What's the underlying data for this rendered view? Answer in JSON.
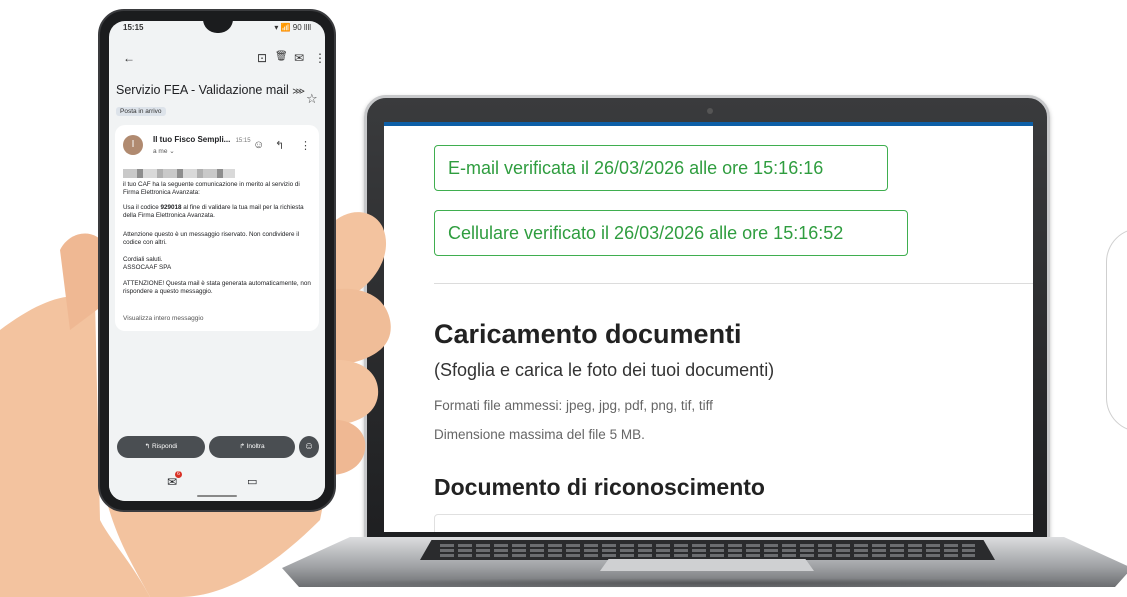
{
  "phone": {
    "status_time": "15:15",
    "status_icons": "▾ 📶 90 llll",
    "toolbar": {
      "back": "←",
      "archive": "⊡",
      "delete": "🗑",
      "mark": "✉",
      "more": "⋮"
    },
    "subject": "Servizio FEA - Validazione mail",
    "subject_arrow": "⋙",
    "label_chip": "Posta in arrivo",
    "message": {
      "avatar_letter": "I",
      "sender": "Il tuo Fisco Sempli...",
      "time": "15:15",
      "to": "a me ⌄",
      "intro": "il tuo CAF ha la seguente comunicazione in merito al servizio di Firma Elettronica Avanzata:",
      "code_prefix": "Usa il codice ",
      "code": "929018",
      "code_suffix": " al fine di validare la tua mail per la richiesta della Firma Elettronica Avanzata.",
      "attention": "Attenzione questo è un messaggio riservato. Non condividere il codice con altri.",
      "greeting": "Cordiali saluti.",
      "company": "ASSOCAAF SPA",
      "warning": "ATTENZIONE! Questa mail è stata generata automaticamente, non rispondere a questo messaggio.",
      "view_full": "Visualizza intero messaggio"
    },
    "actions": {
      "reply": "↰  Rispondi",
      "forward": "↱  Inoltra"
    },
    "nav": {
      "mail_badge": "6"
    }
  },
  "laptop": {
    "email_verified": "E-mail verificata il 26/03/2026 alle ore 15:16:16",
    "phone_verified": "Cellulare verificato il 26/03/2026 alle ore 15:16:52",
    "upload_title": "Caricamento documenti",
    "upload_subtitle": "(Sfoglia e carica le foto dei tuoi documenti)",
    "formats": "Formati file ammessi: jpeg, jpg, pdf, png, tif, tiff",
    "max_size": "Dimensione massima del file 5 MB.",
    "doc_title": "Documento di riconoscimento"
  },
  "colors": {
    "verified_green": "#3fae4f",
    "top_bar_blue": "#0d5fa7"
  }
}
